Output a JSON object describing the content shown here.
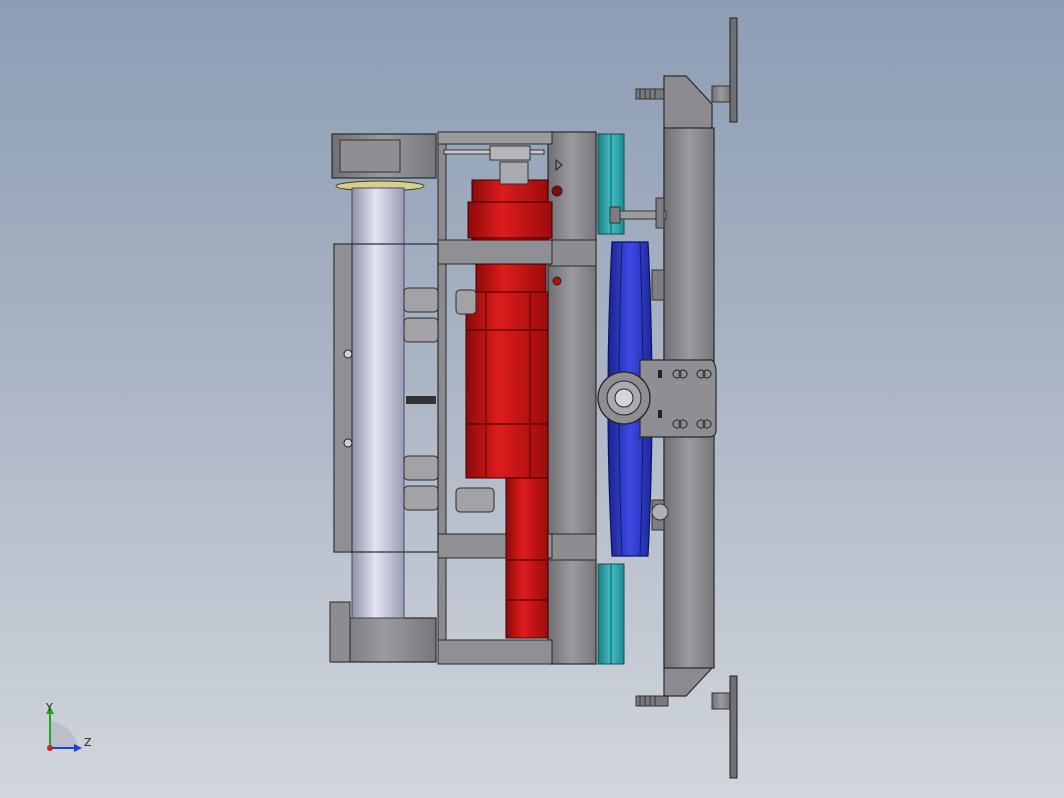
{
  "colors": {
    "background_top": "#8d9db4",
    "background_bottom": "#d2d6dc",
    "steel": "#8f8f94",
    "steel_dark": "#6e6e73",
    "motor_red": "#c81414",
    "pulley_blue": "#2d3ad0",
    "belt_teal": "#2fa3a8",
    "shaft_lavender": "#c7c9e0",
    "axis_x": "#d21f1f",
    "axis_y": "#1fa81f",
    "axis_z": "#1f3fd2"
  },
  "triad": {
    "y_label": "Y",
    "z_label": "Z"
  }
}
